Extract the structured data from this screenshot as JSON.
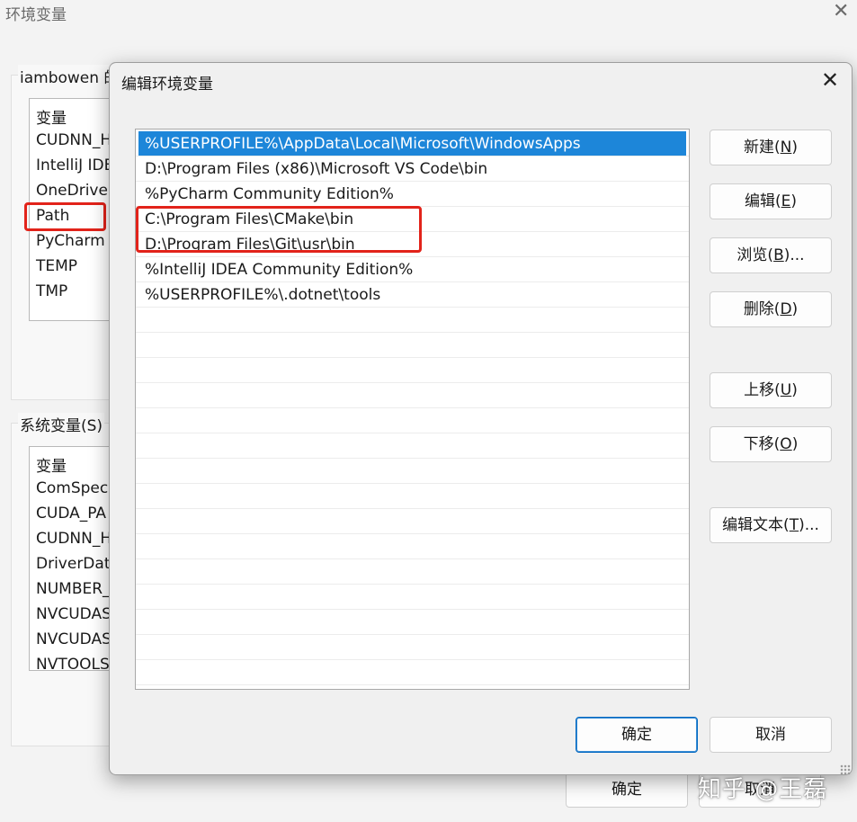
{
  "background_window": {
    "title": "环境变量",
    "user_group_label": "iambowen 的",
    "user_vars": [
      "变量",
      "CUDNN_H",
      "IntelliJ IDE",
      "OneDrive",
      "Path",
      "PyCharm",
      "TEMP",
      "TMP"
    ],
    "system_group_label": "系统变量(S)",
    "system_vars": [
      "变量",
      "ComSpec",
      "CUDA_PA",
      "CUDNN_H",
      "DriverDat",
      "NUMBER_",
      "NVCUDAS",
      "NVCUDAS",
      "NVTOOLS"
    ],
    "ok_label": "确定",
    "cancel_label": "取消"
  },
  "dialog": {
    "title": "编辑环境变量",
    "paths": [
      "%USERPROFILE%\\AppData\\Local\\Microsoft\\WindowsApps",
      "D:\\Program Files (x86)\\Microsoft VS Code\\bin",
      "%PyCharm Community Edition%",
      "C:\\Program Files\\CMake\\bin",
      "D:\\Program Files\\Git\\usr\\bin",
      "%IntelliJ IDEA Community Edition%",
      "%USERPROFILE%\\.dotnet\\tools"
    ],
    "selected_index": 0,
    "buttons": {
      "new": {
        "text": "新建(",
        "key": "N",
        "end": ")"
      },
      "edit": {
        "text": "编辑(",
        "key": "E",
        "end": ")"
      },
      "browse": {
        "text": "浏览(",
        "key": "B",
        "end": ")..."
      },
      "delete": {
        "text": "删除(",
        "key": "D",
        "end": ")"
      },
      "move_up": {
        "text": "上移(",
        "key": "U",
        "end": ")"
      },
      "move_down": {
        "text": "下移(",
        "key": "O",
        "end": ")"
      },
      "edit_text": {
        "text": "编辑文本(",
        "key": "T",
        "end": ")..."
      }
    },
    "ok_label": "确定",
    "cancel_label": "取消"
  },
  "watermark": "知乎 @王磊",
  "colors": {
    "selection": "#1d86d9",
    "highlight_box": "#e2231a",
    "primary_border": "#0067c0"
  }
}
